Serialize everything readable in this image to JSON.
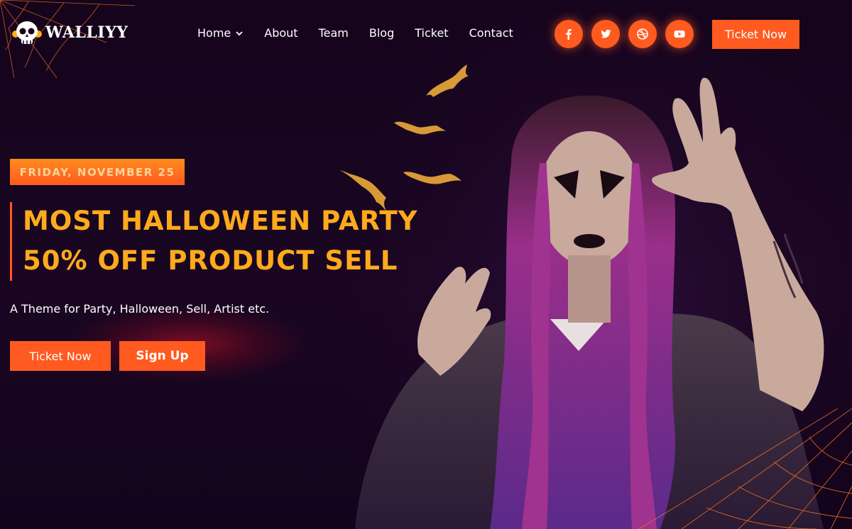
{
  "brand": {
    "name": "WALLIYY",
    "logo_icon": "skull-icon"
  },
  "nav": {
    "items": [
      {
        "label": "Home",
        "has_dropdown": true
      },
      {
        "label": "About"
      },
      {
        "label": "Team"
      },
      {
        "label": "Blog"
      },
      {
        "label": "Ticket"
      },
      {
        "label": "Contact"
      }
    ]
  },
  "socials": [
    {
      "icon": "facebook-icon"
    },
    {
      "icon": "twitter-icon"
    },
    {
      "icon": "dribbble-icon"
    },
    {
      "icon": "youtube-icon"
    }
  ],
  "header": {
    "cta_label": "Ticket Now"
  },
  "hero": {
    "date": "FRIDAY, NOVEMBER 25",
    "title_line1": "MOST HALLOWEEN PARTY",
    "title_line2": "50% OFF PRODUCT SELL",
    "subtitle": "A Theme for Party, Halloween, Sell, Artist etc.",
    "primary_cta": "Ticket Now",
    "secondary_cta": "Sign Up"
  },
  "colors": {
    "accent": "#ff5a1f",
    "title": "#ffaa1c",
    "background": "#15041c",
    "bats": "#d89a36"
  }
}
